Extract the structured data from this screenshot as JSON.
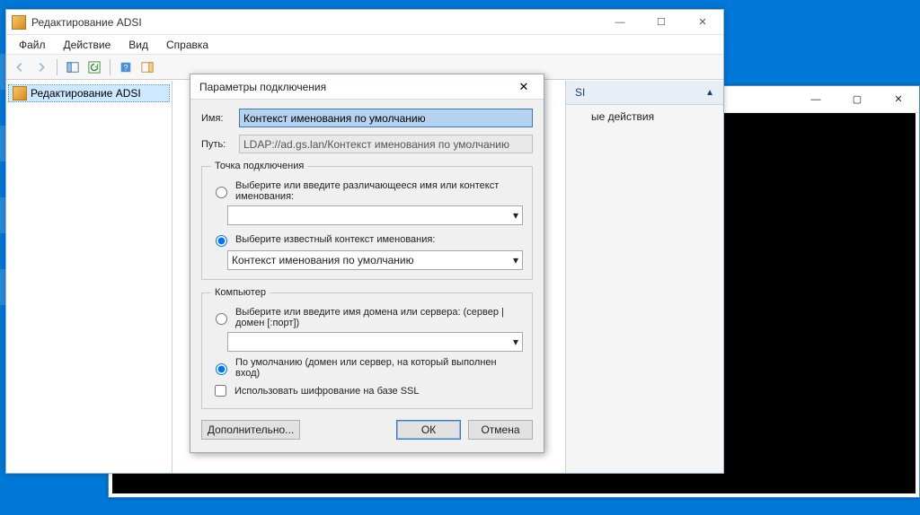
{
  "main_window": {
    "title": "Редактирование ADSI",
    "menu": {
      "file": "Файл",
      "action": "Действие",
      "view": "Вид",
      "help": "Справка"
    },
    "tree": {
      "root": "Редактирование ADSI"
    },
    "actions_panel": {
      "header_suffix": "SI",
      "more_actions": "ые действия"
    }
  },
  "dialog": {
    "title": "Параметры подключения",
    "name_label": "Имя:",
    "name_value": "Контекст именования по умолчанию",
    "path_label": "Путь:",
    "path_value": "LDAP://ad.gs.lan/Контекст именования по умолчанию",
    "connection_point": {
      "legend": "Точка подключения",
      "opt_dn": "Выберите или введите различающееся имя или контекст именования:",
      "opt_known": "Выберите известный контекст именования:",
      "known_selected": "Контекст именования по умолчанию",
      "dn_value": ""
    },
    "computer": {
      "legend": "Компьютер",
      "opt_domain": "Выберите или введите имя домена или сервера: (сервер | домен [:порт])",
      "domain_value": "",
      "opt_default": "По умолчанию (домен или сервер, на который выполнен вход)",
      "ssl": "Использовать шифрование на базе SSL"
    },
    "buttons": {
      "advanced": "Дополнительно...",
      "ok": "ОК",
      "cancel": "Отмена"
    }
  },
  "bgwin": {
    "min": "—",
    "max": "▢",
    "close": "✕"
  },
  "winctrl": {
    "min": "—",
    "max": "☐",
    "close": "✕"
  }
}
